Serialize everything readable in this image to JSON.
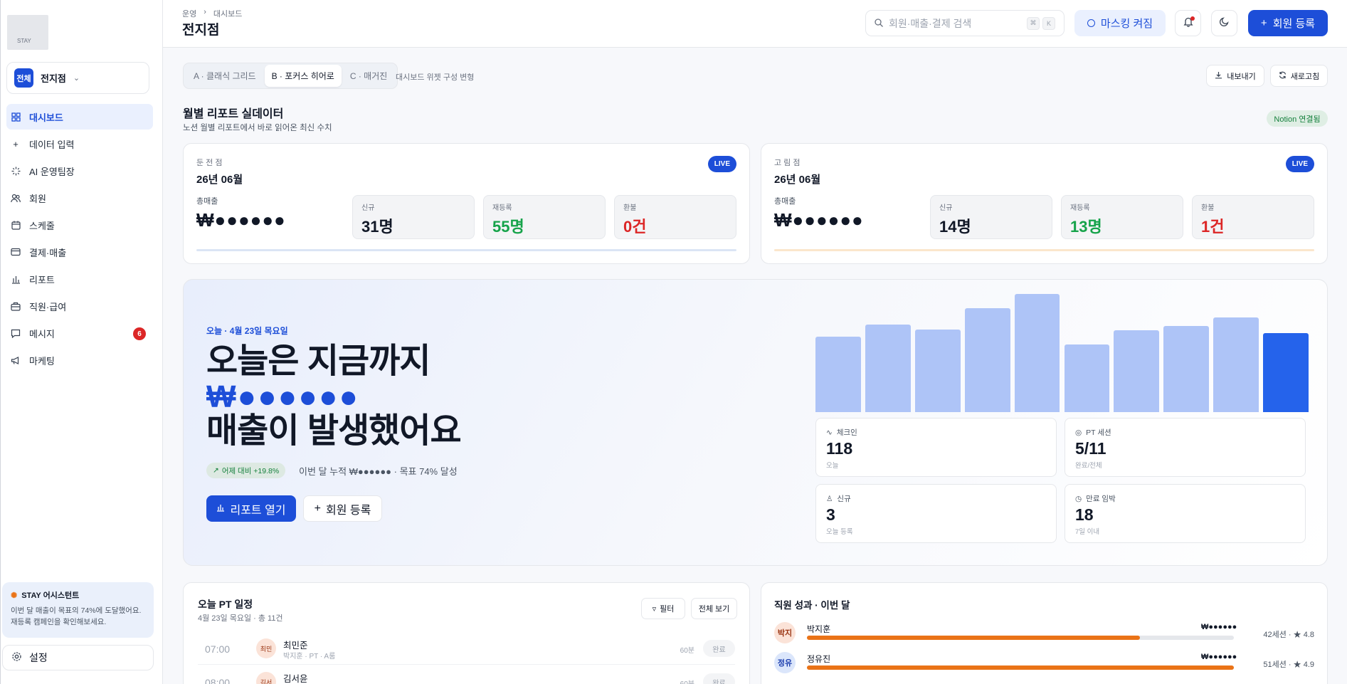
{
  "sidebar": {
    "logo_text": "STAY",
    "branch": {
      "tag": "전체",
      "name": "전지점"
    },
    "items": [
      {
        "label": "대시보드",
        "icon": "grid-icon",
        "active": true
      },
      {
        "label": "데이터 입력",
        "icon": "plus-icon"
      },
      {
        "label": "AI 운영팀장",
        "icon": "sparkle-icon"
      },
      {
        "label": "회원",
        "icon": "users-icon"
      },
      {
        "label": "스케줄",
        "icon": "calendar-icon"
      },
      {
        "label": "결제·매출",
        "icon": "card-icon"
      },
      {
        "label": "리포트",
        "icon": "bar-chart-icon"
      },
      {
        "label": "직원·급여",
        "icon": "briefcase-icon"
      },
      {
        "label": "메시지",
        "icon": "message-icon",
        "badge": "6"
      },
      {
        "label": "마케팅",
        "icon": "megaphone-icon"
      }
    ],
    "assistant": {
      "title": "STAY 어시스턴트",
      "text": "이번 달 매출이 목표의 74%에 도달했어요. 재등록 캠페인을 확인해보세요."
    },
    "settings_label": "설정"
  },
  "header": {
    "breadcrumb": [
      "운영",
      "대시보드"
    ],
    "title": "전지점",
    "search_placeholder": "회원·매출·결제 검색",
    "kbd": [
      "⌘",
      "K"
    ],
    "masking_label": "마스킹 켜짐",
    "register_label": "회원 등록"
  },
  "toolbar": {
    "variants": [
      "A · 클래식 그리드",
      "B · 포커스 히어로",
      "C · 매거진"
    ],
    "variant_caption": "대시보드 위젯 구성 변형",
    "export_label": "내보내기",
    "refresh_label": "새로고침"
  },
  "reports": {
    "title": "월별 리포트 실데이터",
    "subtitle": "노션 월별 리포트에서 바로 읽어온 최신 수치",
    "notion_badge": "Notion 연결됨",
    "cards": [
      {
        "branch": "둔 전 점",
        "month": "26년 06월",
        "live": "LIVE",
        "total_label": "총매출",
        "total": "₩●●●●●●",
        "new_label": "신규",
        "new": "31명",
        "re_label": "재등록",
        "re": "55명",
        "refund_label": "환불",
        "refund": "0건",
        "bar_color": "#dbe5f5"
      },
      {
        "branch": "고 림 점",
        "month": "26년 06월",
        "live": "LIVE",
        "total_label": "총매출",
        "total": "₩●●●●●●",
        "new_label": "신규",
        "new": "14명",
        "re_label": "재등록",
        "re": "13명",
        "refund_label": "환불",
        "refund": "1건",
        "bar_color": "#fbe6cc"
      }
    ]
  },
  "hero": {
    "date": "오늘 · 4월 23일 목요일",
    "line1": "오늘은 지금까지",
    "line2": "₩●●●●●●",
    "line3": "매출이 발생했어요",
    "pill": "어제 대비 +19.8%",
    "note": "이번 달 누적 ₩●●●●●● · 목표 74% 달성",
    "btn_report": "리포트 열기",
    "btn_register": "회원 등록",
    "bars": [
      0.64,
      0.74,
      0.7,
      0.88,
      1.0,
      0.57,
      0.69,
      0.73,
      0.8,
      0.67
    ],
    "stats": [
      {
        "label": "체크인",
        "value": "118",
        "sub": "오늘",
        "icon": "pulse-icon"
      },
      {
        "label": "PT 세션",
        "value": "5/11",
        "sub": "완료/전체",
        "icon": "eye-icon"
      },
      {
        "label": "신규",
        "value": "3",
        "sub": "오늘 등록",
        "icon": "user-icon"
      },
      {
        "label": "만료 임박",
        "value": "18",
        "sub": "7일 이내",
        "icon": "clock-icon"
      }
    ]
  },
  "pt": {
    "title": "오늘 PT 일정",
    "subtitle": "4월 23일 목요일 · 총 11건",
    "filter_label": "필터",
    "all_label": "전체 보기",
    "rows": [
      {
        "time": "07:00",
        "avatar": "최민",
        "name": "최민준",
        "sub": "박지훈 · PT · A룸",
        "dur": "60분",
        "status": "완료"
      },
      {
        "time": "08:00",
        "avatar": "김서",
        "name": "김서윤",
        "sub": "",
        "dur": "60분",
        "status": "완료"
      }
    ]
  },
  "staff": {
    "title": "직원 성과 · 이번 달",
    "rows": [
      {
        "avatar": "박지",
        "name": "박지훈",
        "amount": "₩●●●●●●",
        "progress": 0.78,
        "meta": "42세션 · ★ 4.8",
        "bg": "#fbe3d8",
        "fg": "#9a3412"
      },
      {
        "avatar": "정유",
        "name": "정유진",
        "amount": "₩●●●●●●",
        "progress": 1.0,
        "meta": "51세션 · ★ 4.9",
        "bg": "#dbe6fb",
        "fg": "#1e40af"
      }
    ]
  }
}
